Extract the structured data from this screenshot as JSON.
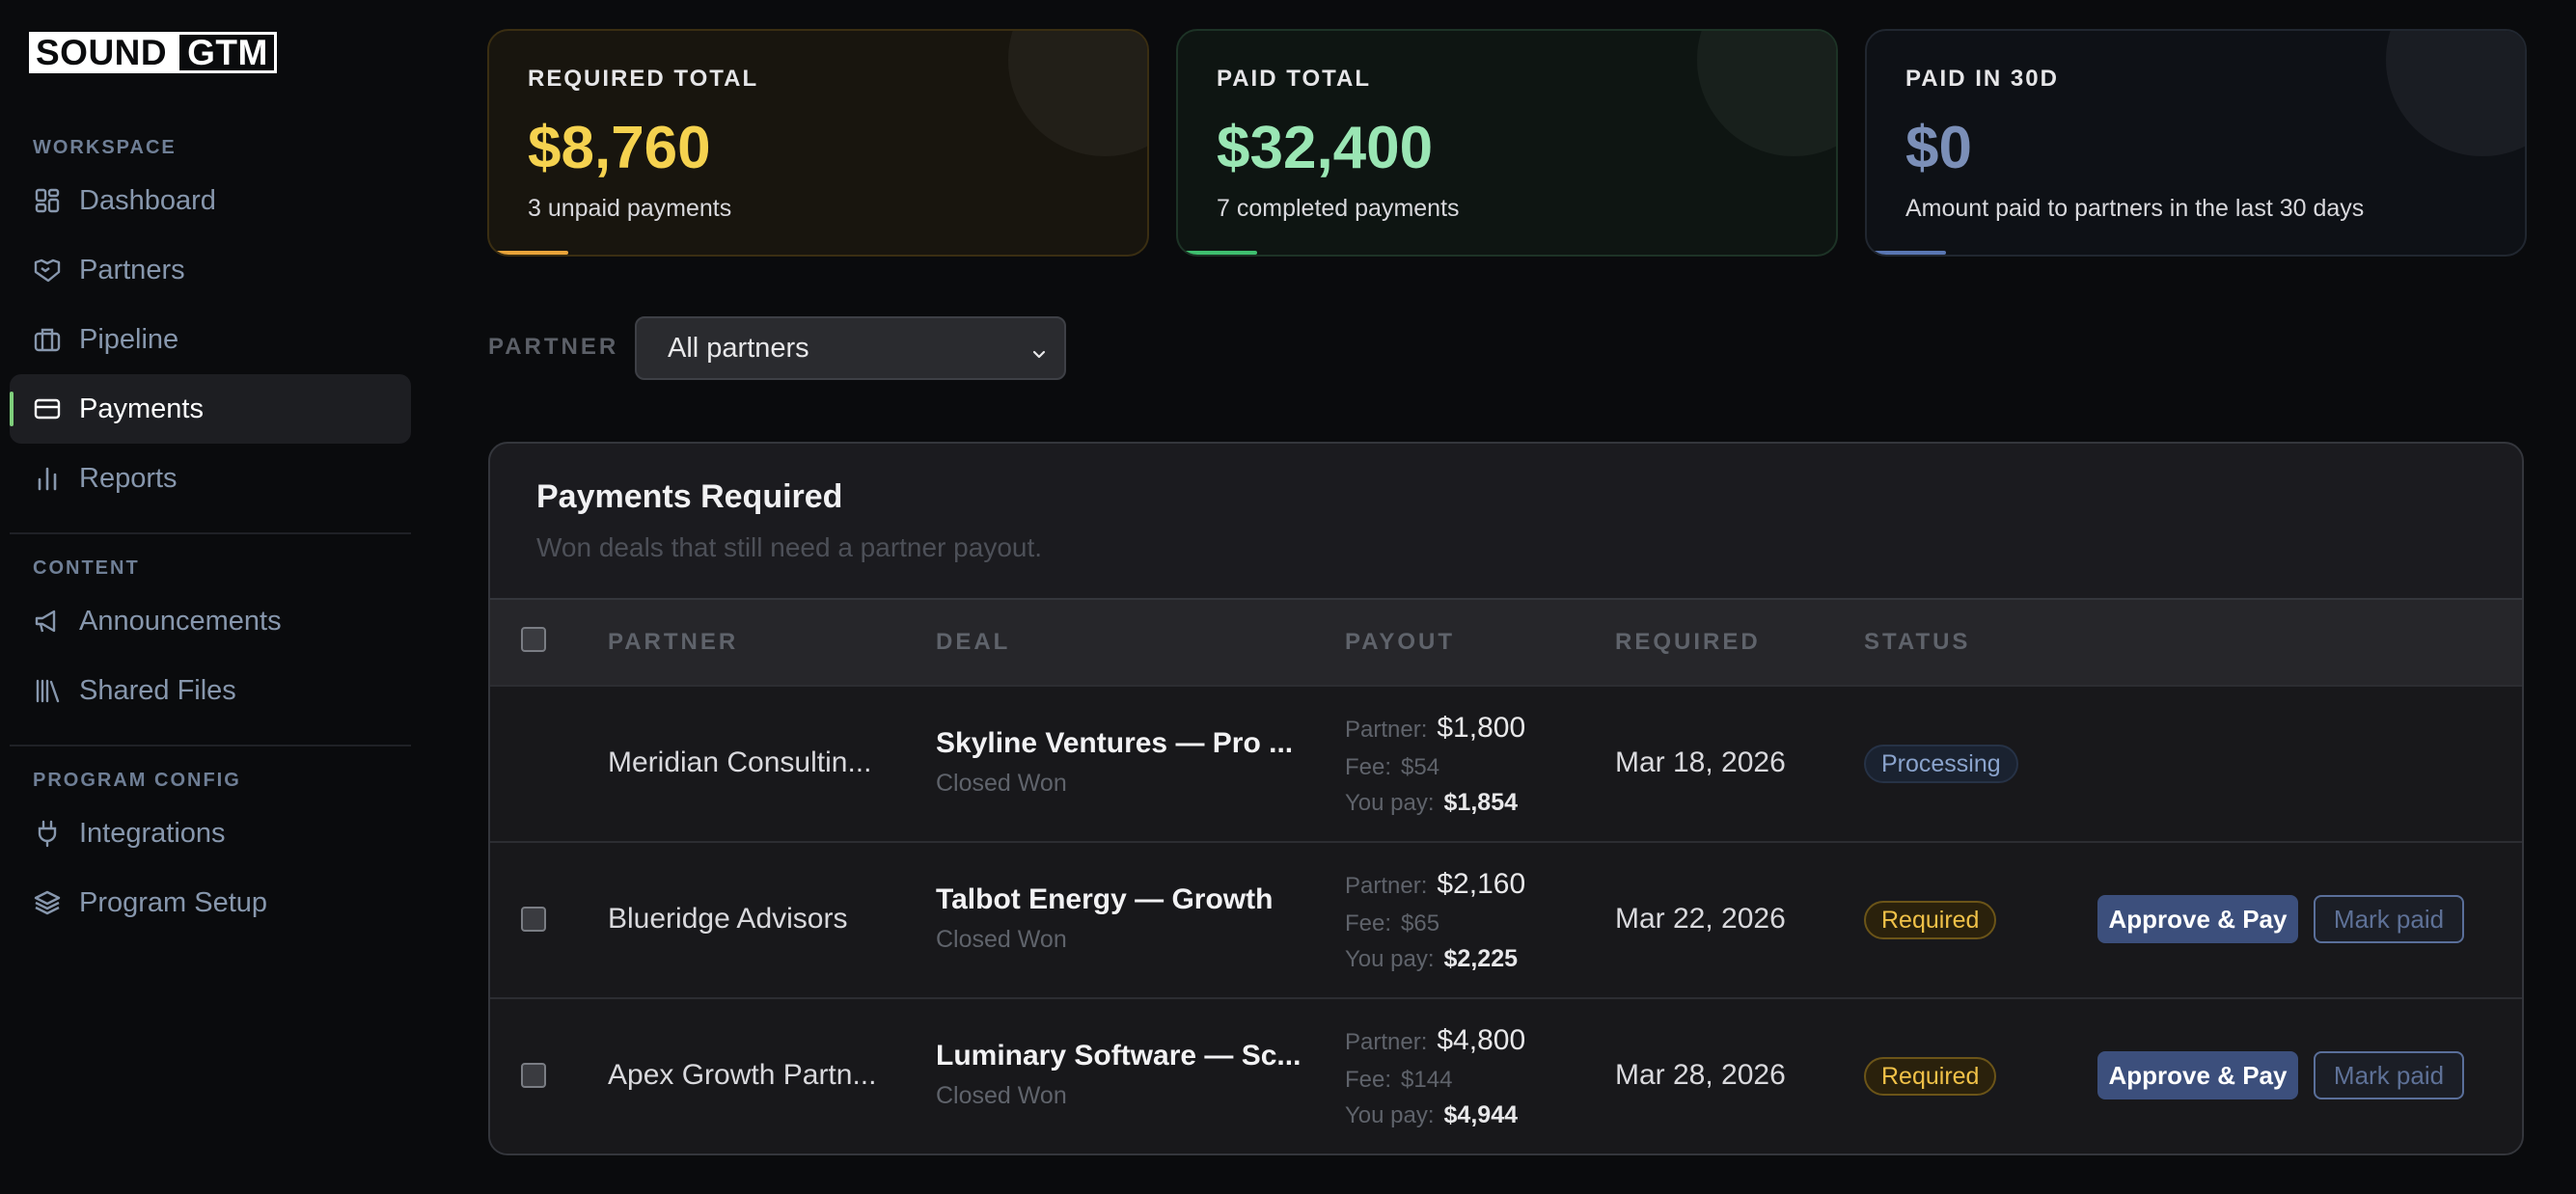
{
  "brand": {
    "part1": "SOUND",
    "part2": "GTM"
  },
  "sidebar": {
    "sections": [
      {
        "label": "WORKSPACE",
        "items": [
          {
            "label": "Dashboard",
            "icon": "grid-icon"
          },
          {
            "label": "Partners",
            "icon": "handshake-icon"
          },
          {
            "label": "Pipeline",
            "icon": "briefcase-icon"
          },
          {
            "label": "Payments",
            "icon": "credit-card-icon",
            "active": true
          },
          {
            "label": "Reports",
            "icon": "bar-chart-icon"
          }
        ]
      },
      {
        "label": "CONTENT",
        "items": [
          {
            "label": "Announcements",
            "icon": "megaphone-icon"
          },
          {
            "label": "Shared Files",
            "icon": "library-icon"
          }
        ]
      },
      {
        "label": "PROGRAM CONFIG",
        "items": [
          {
            "label": "Integrations",
            "icon": "plug-icon"
          },
          {
            "label": "Program Setup",
            "icon": "layers-icon"
          }
        ]
      }
    ],
    "active_accent": "#7fcf7c"
  },
  "stats": {
    "required": {
      "label": "REQUIRED TOTAL",
      "value": "$8,760",
      "sub": "3 unpaid payments",
      "color": "#f5d24f"
    },
    "paid": {
      "label": "PAID TOTAL",
      "value": "$32,400",
      "sub": "7 completed payments",
      "color": "#9ae6b4"
    },
    "paid30": {
      "label": "PAID IN 30D",
      "value": "$0",
      "sub": "Amount paid to partners in the last 30 days",
      "color": "#7b8fb8"
    }
  },
  "filter": {
    "label": "PARTNER",
    "selected": "All partners"
  },
  "table": {
    "title": "Payments Required",
    "subtitle": "Won deals that still need a partner payout.",
    "columns": {
      "partner": "PARTNER",
      "deal": "DEAL",
      "payout": "PAYOUT",
      "required": "REQUIRED",
      "status": "STATUS"
    },
    "payout_labels": {
      "partner": "Partner:",
      "fee": "Fee:",
      "you_pay": "You pay:"
    },
    "rows": [
      {
        "partner": "Meridian Consultin...",
        "deal": "Skyline Ventures — Pro ...",
        "stage": "Closed Won",
        "payout_partner": "$1,800",
        "payout_fee": "$54",
        "payout_total": "$1,854",
        "required": "Mar 18, 2026",
        "status": "Processing",
        "checkbox": false,
        "actions": null
      },
      {
        "partner": "Blueridge Advisors",
        "deal": "Talbot Energy — Growth",
        "stage": "Closed Won",
        "payout_partner": "$2,160",
        "payout_fee": "$65",
        "payout_total": "$2,225",
        "required": "Mar 22, 2026",
        "status": "Required",
        "checkbox": true,
        "actions": {
          "approve": "Approve & Pay",
          "mark": "Mark paid"
        }
      },
      {
        "partner": "Apex Growth Partn...",
        "deal": "Luminary Software — Sc...",
        "stage": "Closed Won",
        "payout_partner": "$4,800",
        "payout_fee": "$144",
        "payout_total": "$4,944",
        "required": "Mar 28, 2026",
        "status": "Required",
        "checkbox": true,
        "actions": {
          "approve": "Approve & Pay",
          "mark": "Mark paid"
        }
      }
    ]
  }
}
